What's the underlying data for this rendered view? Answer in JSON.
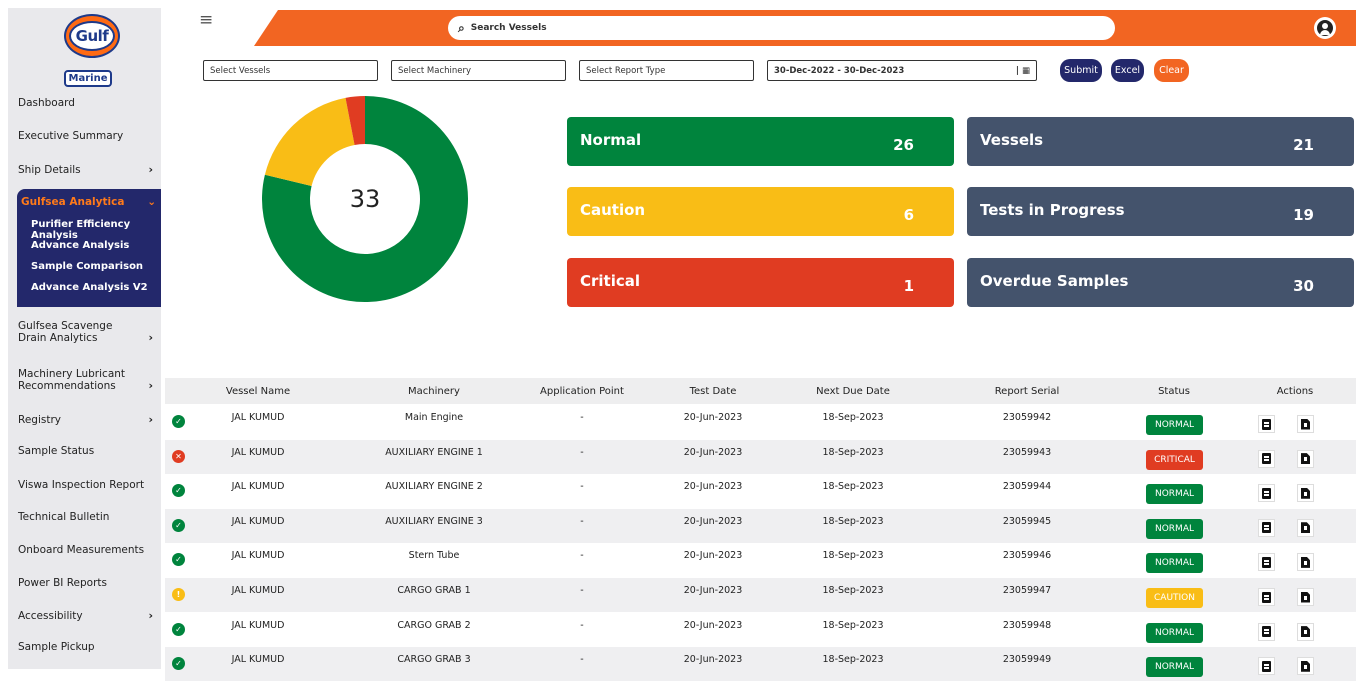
{
  "brand": {
    "logo_text": "Gulf",
    "sub_text": "Marine"
  },
  "sidebar": {
    "items": [
      {
        "label": "Dashboard"
      },
      {
        "label": "Executive Summary"
      },
      {
        "label": "Ship Details"
      },
      {
        "label": "Gulfsea Scavenge Drain Analytics"
      },
      {
        "label": "Machinery Lubricant Recommendations"
      },
      {
        "label": "Registry"
      },
      {
        "label": "Sample Status"
      },
      {
        "label": "Viswa Inspection Report"
      },
      {
        "label": "Technical Bulletin"
      },
      {
        "label": "Onboard Measurements"
      },
      {
        "label": "Power BI Reports"
      },
      {
        "label": "Accessibility"
      },
      {
        "label": "Sample Pickup"
      }
    ],
    "group": {
      "label": "Gulfsea Analytica",
      "subitems": [
        "Purifier Efficiency Analysis",
        "Advance Analysis",
        "Sample Comparison",
        "Advance Analysis V2"
      ]
    }
  },
  "header": {
    "search_placeholder": "Search Vessels"
  },
  "filters": {
    "vessels": "Select Vessels",
    "machinery": "Select Machinery",
    "report_type": "Select Report Type",
    "date_range": "30-Dec-2022 - 30-Dec-2023",
    "submit": "Submit",
    "excel": "Excel",
    "clear": "Clear"
  },
  "chart_data": {
    "type": "donut",
    "total": "33",
    "segments": [
      {
        "name": "Normal",
        "value": 26,
        "color": "#00843d"
      },
      {
        "name": "Caution",
        "value": 6,
        "color": "#f9bd16"
      },
      {
        "name": "Critical",
        "value": 1,
        "color": "#e03c22"
      }
    ]
  },
  "cards": {
    "normal": {
      "label": "Normal",
      "value": "26",
      "color": "#00843d"
    },
    "caution": {
      "label": "Caution",
      "value": "6",
      "color": "#f9bd16"
    },
    "critical": {
      "label": "Critical",
      "value": "1",
      "color": "#e03c22"
    },
    "vessels": {
      "label": "Vessels",
      "value": "21",
      "color": "#44536c"
    },
    "tests": {
      "label": "Tests in Progress",
      "value": "19",
      "color": "#44536c"
    },
    "overdue": {
      "label": "Overdue Samples",
      "value": "30",
      "color": "#44536c"
    }
  },
  "table": {
    "headers": {
      "vessel": "Vessel Name",
      "machinery": "Machinery",
      "app_point": "Application Point",
      "test_date": "Test Date",
      "next_due": "Next Due Date",
      "serial": "Report Serial",
      "status": "Status",
      "actions": "Actions"
    },
    "rows": [
      {
        "vessel": "JAL KUMUD",
        "machinery": "Main Engine",
        "app_point": "-",
        "test_date": "20-Jun-2023",
        "next_due": "18-Sep-2023",
        "serial": "23059942",
        "status": "NORMAL"
      },
      {
        "vessel": "JAL KUMUD",
        "machinery": "AUXILIARY ENGINE 1",
        "app_point": "-",
        "test_date": "20-Jun-2023",
        "next_due": "18-Sep-2023",
        "serial": "23059943",
        "status": "CRITICAL"
      },
      {
        "vessel": "JAL KUMUD",
        "machinery": "AUXILIARY ENGINE 2",
        "app_point": "-",
        "test_date": "20-Jun-2023",
        "next_due": "18-Sep-2023",
        "serial": "23059944",
        "status": "NORMAL"
      },
      {
        "vessel": "JAL KUMUD",
        "machinery": "AUXILIARY ENGINE 3",
        "app_point": "-",
        "test_date": "20-Jun-2023",
        "next_due": "18-Sep-2023",
        "serial": "23059945",
        "status": "NORMAL"
      },
      {
        "vessel": "JAL KUMUD",
        "machinery": "Stern Tube",
        "app_point": "-",
        "test_date": "20-Jun-2023",
        "next_due": "18-Sep-2023",
        "serial": "23059946",
        "status": "NORMAL"
      },
      {
        "vessel": "JAL KUMUD",
        "machinery": "CARGO GRAB 1",
        "app_point": "-",
        "test_date": "20-Jun-2023",
        "next_due": "18-Sep-2023",
        "serial": "23059947",
        "status": "CAUTION"
      },
      {
        "vessel": "JAL KUMUD",
        "machinery": "CARGO GRAB 2",
        "app_point": "-",
        "test_date": "20-Jun-2023",
        "next_due": "18-Sep-2023",
        "serial": "23059948",
        "status": "NORMAL"
      },
      {
        "vessel": "JAL KUMUD",
        "machinery": "CARGO GRAB 3",
        "app_point": "-",
        "test_date": "20-Jun-2023",
        "next_due": "18-Sep-2023",
        "serial": "23059949",
        "status": "NORMAL"
      }
    ]
  },
  "status_colors": {
    "NORMAL": "#00843d",
    "CRITICAL": "#e03c22",
    "CAUTION": "#f9bd16"
  }
}
